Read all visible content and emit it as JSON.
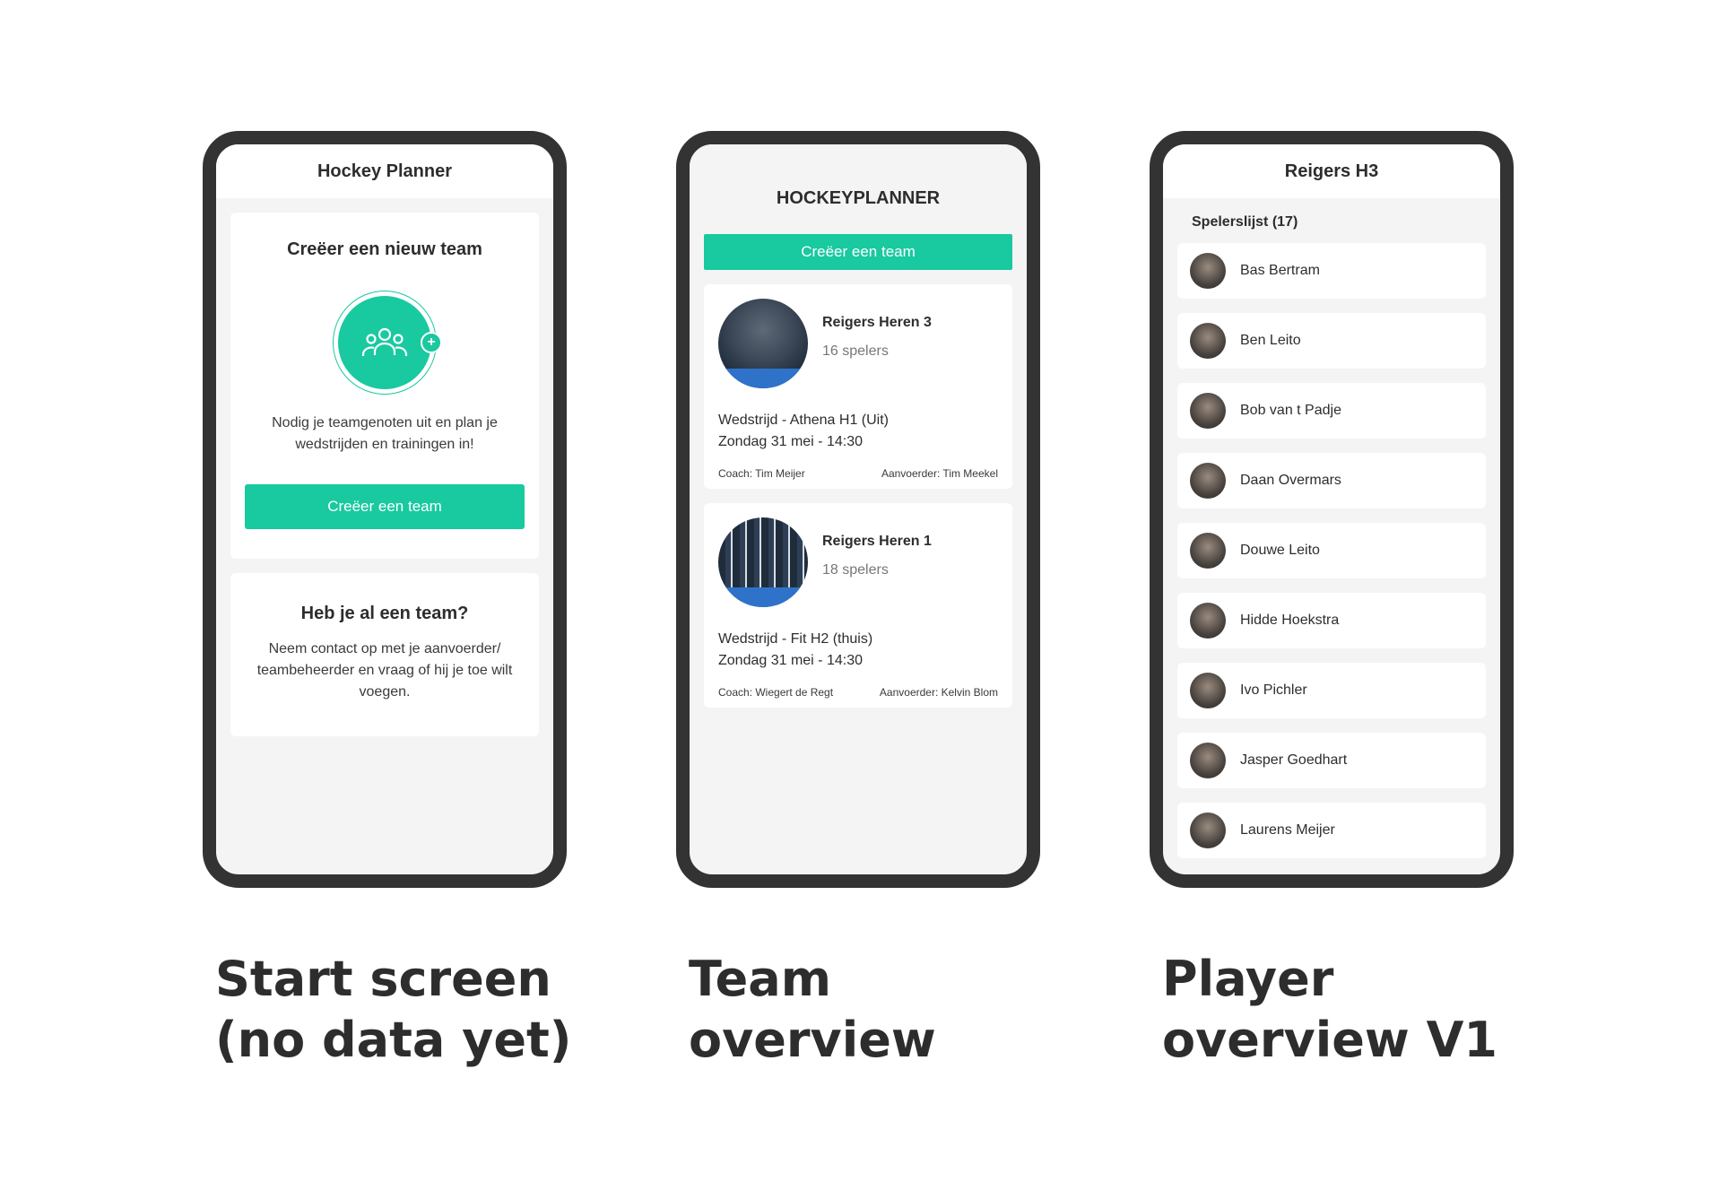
{
  "start_screen": {
    "header": "Hockey Planner",
    "create_card": {
      "title": "Creëer een nieuw team",
      "description": "Nodig je teamgenoten uit en plan je wedstrijden en trainingen in!",
      "button": "Creëer een team"
    },
    "join_card": {
      "title": "Heb je al een team?",
      "description": "Neem contact op met je aanvoerder/ teambeheerder en vraag of hij je toe wilt voegen."
    }
  },
  "team_overview": {
    "header": "HOCKEYPLANNER",
    "button": "Creëer een team",
    "teams": [
      {
        "name": "Reigers Heren 3",
        "count": "16 spelers",
        "match": "Wedstrijd - Athena H1 (Uit)",
        "date": "Zondag 31 mei - 14:30",
        "coach": "Coach: Tim Meijer",
        "captain": "Aanvoerder: Tim Meekel"
      },
      {
        "name": "Reigers Heren 1",
        "count": "18 spelers",
        "match": "Wedstrijd - Fit H2 (thuis)",
        "date": "Zondag 31 mei - 14:30",
        "coach": "Coach: Wiegert de Regt",
        "captain": "Aanvoerder: Kelvin Blom"
      }
    ]
  },
  "player_overview": {
    "header": "Reigers H3",
    "list_title": "Spelerslijst (17)",
    "players": [
      "Bas Bertram",
      "Ben Leito",
      "Bob van t Padje",
      "Daan Overmars",
      "Douwe Leito",
      "Hidde Hoekstra",
      "Ivo Pichler",
      "Jasper Goedhart",
      "Laurens Meijer"
    ]
  },
  "captions": {
    "start": "Start screen\n(no data yet)",
    "team": "Team\noverview",
    "player": "Player\noverview V1"
  },
  "colors": {
    "accent": "#19c9a0",
    "frame": "#333333",
    "screen_bg": "#f4f4f4"
  }
}
